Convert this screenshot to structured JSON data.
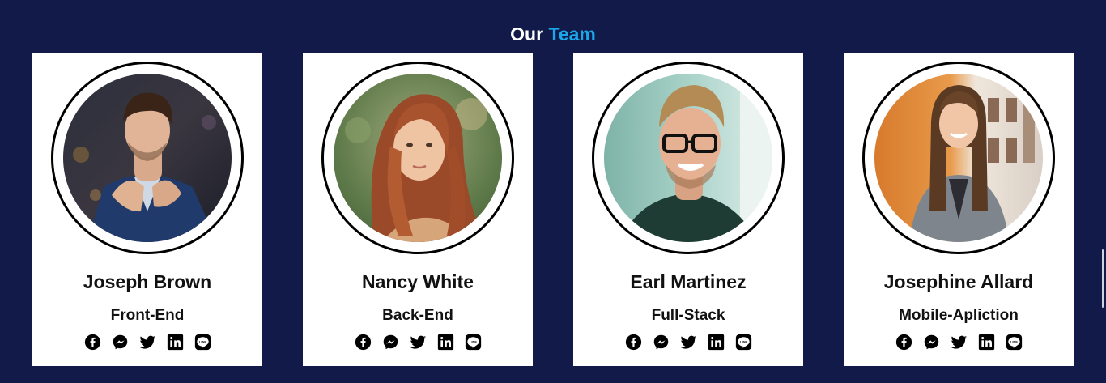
{
  "section": {
    "title_prefix": "Our",
    "title_accent": "Team",
    "accent_color": "#1aa6e8",
    "background_color": "#111a48"
  },
  "members": [
    {
      "name": "Joseph Brown",
      "role": "Front-End",
      "photo": "man-in-navy-suit-photo"
    },
    {
      "name": "Nancy White",
      "role": "Back-End",
      "photo": "woman-with-auburn-hair-photo"
    },
    {
      "name": "Earl Martinez",
      "role": "Full-Stack",
      "photo": "smiling-man-with-glasses-photo"
    },
    {
      "name": "Josephine Allard",
      "role": "Mobile-Apliction",
      "photo": "smiling-woman-in-grey-coat-photo"
    }
  ],
  "social_icons": [
    "facebook-icon",
    "messenger-icon",
    "twitter-icon",
    "linkedin-icon",
    "line-icon"
  ]
}
